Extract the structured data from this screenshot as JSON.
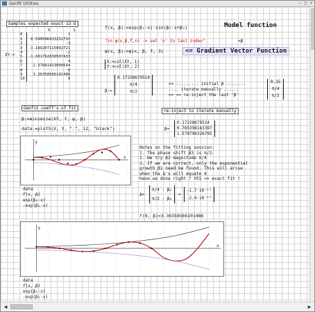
{
  "window": {
    "title": "Genfit Utilities"
  },
  "samples_label": "Samples expected exact 13 U",
  "xy_label": "XY:=",
  "xy_table": {
    "col_headers": [
      "0",
      "1"
    ],
    "rows": [
      [
        "0",
        "1"
      ],
      [
        "1",
        "0.540596413252715"
      ],
      [
        "2",
        "-3"
      ],
      [
        "3",
        "-1.189207115002721"
      ],
      [
        "4",
        "-2"
      ],
      [
        "5",
        "-1.681792830507433"
      ],
      [
        "6",
        "4"
      ],
      [
        "7",
        "2.37841423000544"
      ],
      [
        "8",
        "6"
      ],
      [
        "9",
        "3.36358566101486"
      ],
      [
        "10",
        "0"
      ]
    ]
  },
  "model_def": "f(x, β):=exp(β₁·x)·sin(β₂·x+β₃)",
  "model_label": "Model function",
  "note_in_phi": "\"in φ(x,β,f,n) -> set 'n' to last index\"",
  "note_in_phi_sym": "=β",
  "phi_def": "φ(x, β):=φ(x, β, f, 3)",
  "gradient_label": "<= Gradient Vector Function",
  "x_def": "X:=col(XY, 1)",
  "y_def": "Y:=col(XY, 2)",
  "beta_init_label": "β:=",
  "beta_init": [
    "0.17228679514",
    "π/4",
    "π/2"
  ],
  "initial_notes": [
    "<= ......... initial β ........",
    ".... iterate manually ......",
    "<= <= re-inject the last 'β'"
  ],
  "beta_last": [
    "0.15",
    "π/4",
    "π/2"
  ],
  "reinject_label": "re-inject to iterate manually",
  "genfit_label": "Genfit coeff's of fit",
  "beta_minimize": "β:=minimize(XY, f, φ, β)",
  "data_plot_def": "data:=plotS(X, Y, \".\", 12, \"black\")",
  "beta_result_label": "β=",
  "beta_result": [
    "0.17228679514",
    "0.785398163397",
    "1.570796326795"
  ],
  "notes_title": "Notes on the fitting session:",
  "notes": [
    "1. The phase shift β3 is π/2.",
    "2. We try β2 magnitude π/4",
    "3. If we are correct, only the exponential",
    "growth β1 need be found. This will arise",
    "when the Δ's will equate 0",
    "Have we done right ? YES => exact fit !"
  ],
  "delta_label": "Δ=",
  "delta_rows": [
    "π/4 - β₂",
    "π/2 - β₃"
  ],
  "delta_vals": [
    "-1.7·10⁻¹⁵",
    "-2.4·10⁻¹⁵"
  ],
  "f_eval": "f(9, β)=3.36358566101486",
  "plot1_legend": [
    "data",
    "f(x, β)",
    "exp(β₁·x)",
    "-exp(β₁·x)"
  ],
  "plot2_legend": [
    "data",
    "f(x, β)",
    "exp(β₁·x)",
    "-exp(β₁·x)"
  ],
  "plot_axis": {
    "y": "y",
    "x": "x"
  },
  "chart_data": [
    {
      "type": "line",
      "title": "",
      "xlabel": "x",
      "ylabel": "y",
      "xlim": [
        -1,
        11
      ],
      "ylim": [
        -8,
        8
      ],
      "series": [
        {
          "name": "data",
          "x": [
            0,
            1,
            2,
            3,
            4,
            5,
            6,
            7,
            8,
            9,
            10
          ],
          "y": [
            0,
            0.84,
            1.19,
            0,
            -1.41,
            -1.68,
            0,
            2.38,
            2.83,
            3.36,
            0
          ]
        },
        {
          "name": "f(x, β)",
          "x": [
            0,
            1,
            2,
            3,
            4,
            5,
            6,
            7,
            8,
            9,
            10
          ],
          "y": [
            1,
            0.84,
            0,
            -1.19,
            -2,
            -1.68,
            0,
            2.38,
            4,
            3.36,
            0
          ]
        },
        {
          "name": "exp(β₁·x)",
          "x": [
            0,
            1,
            2,
            3,
            4,
            5,
            6,
            7,
            8,
            9,
            10
          ],
          "y": [
            1,
            1.19,
            1.41,
            1.68,
            2,
            2.38,
            2.83,
            3.36,
            4,
            4.76,
            5.66
          ]
        },
        {
          "name": "-exp(β₁·x)",
          "x": [
            0,
            1,
            2,
            3,
            4,
            5,
            6,
            7,
            8,
            9,
            10
          ],
          "y": [
            -1,
            -1.19,
            -1.41,
            -1.68,
            -2,
            -2.38,
            -2.83,
            -3.36,
            -4,
            -4.76,
            -5.66
          ]
        }
      ]
    },
    {
      "type": "line",
      "title": "",
      "xlabel": "x",
      "ylabel": "y",
      "xlim": [
        -1,
        16
      ],
      "ylim": [
        -15,
        15
      ],
      "series": [
        {
          "name": "data",
          "x": [
            0,
            1,
            2,
            3,
            4,
            5,
            6,
            7,
            8,
            9,
            10
          ],
          "y": [
            1,
            0.84,
            0,
            -1.19,
            -2,
            -1.68,
            0,
            2.38,
            4,
            3.36,
            0
          ]
        },
        {
          "name": "f(x, β)",
          "x": [
            0,
            1,
            2,
            3,
            4,
            5,
            6,
            7,
            8,
            9,
            10,
            11,
            12,
            13,
            14,
            15
          ],
          "y": [
            1,
            0.84,
            0,
            -1.19,
            -2,
            -1.68,
            0,
            2.38,
            4,
            3.36,
            0,
            -5.66,
            -8,
            -6.73,
            0,
            9.51
          ]
        },
        {
          "name": "exp(β₁·x)",
          "x": [
            0,
            3,
            6,
            9,
            12,
            15
          ],
          "y": [
            1,
            1.68,
            2.83,
            4.76,
            8,
            13.45
          ]
        },
        {
          "name": "-exp(β₁·x)",
          "x": [
            0,
            3,
            6,
            9,
            12,
            15
          ],
          "y": [
            -1,
            -1.68,
            -2.83,
            -4.76,
            -8,
            -13.45
          ]
        }
      ]
    }
  ],
  "colors": {
    "data": "#000000",
    "fit": "#c00000",
    "envelope_pos": "#3b3b3b",
    "envelope_neg": "#6a5acd"
  }
}
